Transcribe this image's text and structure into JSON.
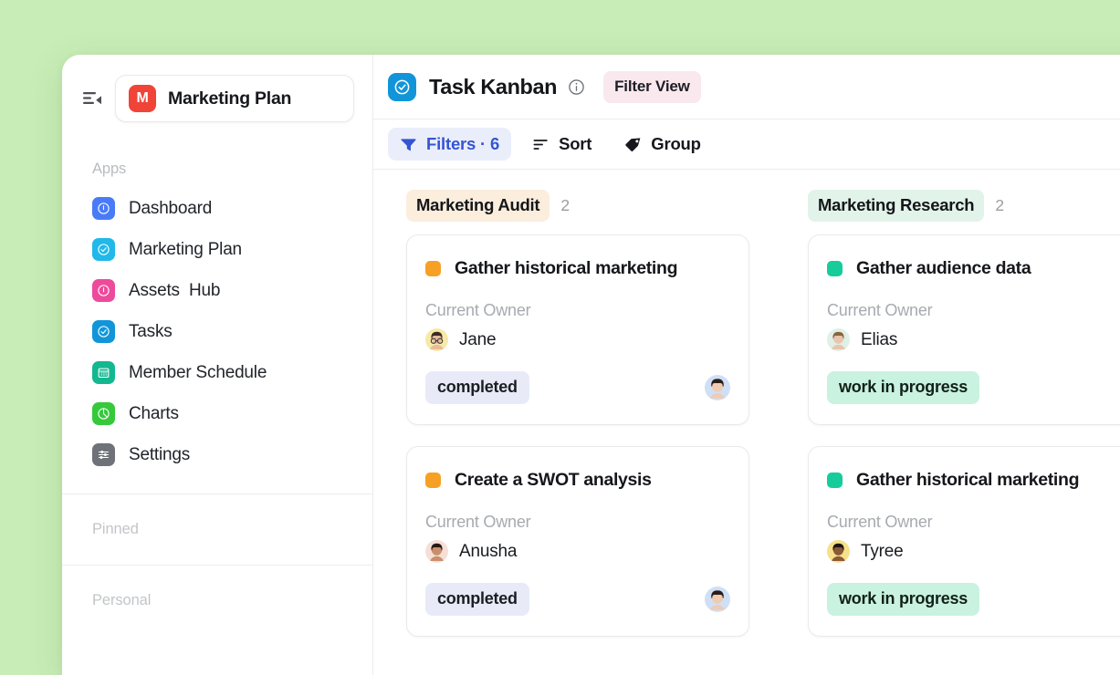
{
  "theme": {
    "page_background": "#c8edb6",
    "accent_blue": "#3554d1",
    "brand_red": "#f04438"
  },
  "sidebar": {
    "collapse_icon": "collapse-sidebar-icon",
    "workspace": {
      "initial": "M",
      "name": "Marketing Plan",
      "avatar_color": "#f04438"
    },
    "apps_label": "Apps",
    "items": [
      {
        "label": "Dashboard",
        "icon": "info-circle-icon",
        "color": "#4a7bf7"
      },
      {
        "label": "Marketing Plan",
        "icon": "check-circle-icon",
        "color": "#21b8ea"
      },
      {
        "label": "Assets  Hub",
        "icon": "info-circle-icon",
        "color": "#ee4a9b"
      },
      {
        "label": "Tasks",
        "icon": "check-circle-icon",
        "color": "#1295d8"
      },
      {
        "label": "Member Schedule",
        "icon": "calendar-icon",
        "color": "#14b890"
      },
      {
        "label": "Charts",
        "icon": "pie-chart-icon",
        "color": "#35c93b"
      },
      {
        "label": "Settings",
        "icon": "sliders-icon",
        "color": "#6f7278"
      }
    ],
    "pinned_label": "Pinned",
    "personal_label": "Personal"
  },
  "header": {
    "board_icon": "check-circle-icon",
    "board_icon_color": "#1295d8",
    "title": "Task Kanban",
    "info_icon": "info-icon",
    "view_badge": "Filter View",
    "view_badge_color": "#fae8ef"
  },
  "toolbar": {
    "filters": {
      "label": "Filters · 6",
      "icon": "funnel-icon",
      "active": true
    },
    "sort": {
      "label": "Sort",
      "icon": "sort-icon"
    },
    "group": {
      "label": "Group",
      "icon": "tag-icon"
    }
  },
  "board": {
    "columns": [
      {
        "name": "Marketing Audit",
        "count": "2",
        "chip_color": "#fbeedd",
        "swatch_color": "#f6a025",
        "status_bg": "#e8eaf8",
        "status_fg": "#1b1d22",
        "cards": [
          {
            "title": "Gather historical marketing",
            "owner_label": "Current Owner",
            "owner": "Jane",
            "owner_avatar": "jane-avatar",
            "status": "completed",
            "assignee_avatar": "assignee-avatar"
          },
          {
            "title": "Create a SWOT analysis",
            "owner_label": "Current Owner",
            "owner": "Anusha",
            "owner_avatar": "anusha-avatar",
            "status": "completed",
            "assignee_avatar": "assignee-avatar"
          }
        ]
      },
      {
        "name": "Marketing Research",
        "count": "2",
        "chip_color": "#e2f3e9",
        "swatch_color": "#15cc9a",
        "status_bg": "#c9f2e0",
        "status_fg": "#11201a",
        "cards": [
          {
            "title": "Gather audience data",
            "owner_label": "Current Owner",
            "owner": "Elias",
            "owner_avatar": "elias-avatar",
            "status": "work in progress",
            "assignee_avatar": null
          },
          {
            "title": "Gather historical marketing",
            "owner_label": "Current Owner",
            "owner": "Tyree",
            "owner_avatar": "tyree-avatar",
            "status": "work in progress",
            "assignee_avatar": null
          }
        ]
      }
    ]
  }
}
